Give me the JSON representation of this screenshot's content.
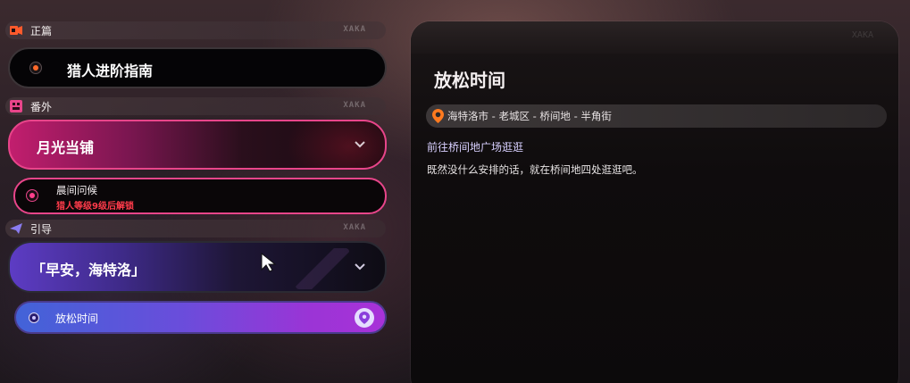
{
  "sections": {
    "main": {
      "label": "正篇",
      "icon": "main-story-icon",
      "mark": "XAKA"
    },
    "side": {
      "label": "番外",
      "icon": "side-story-icon",
      "mark": "XAKA"
    },
    "guide": {
      "label": "引导",
      "icon": "guide-icon",
      "mark": "XAKA"
    }
  },
  "quests": {
    "main": {
      "title": "猎人进阶指南"
    },
    "moon": {
      "title": "月光当铺"
    },
    "moon_sub": {
      "title": "晨间问候",
      "lock_text": "猎人等级9级后解锁"
    },
    "guide": {
      "title": "「早安，海特洛」"
    },
    "relax": {
      "title": "放松时间"
    }
  },
  "detail": {
    "title": "放松时间",
    "location": "海特洛市 - 老城区 - 桥间地 - 半角街",
    "objective": "前往桥间地广场逛逛",
    "description": "既然没什么安排的话，就在桥间地四处逛逛吧。",
    "mark": "XAKA"
  },
  "colors": {
    "accent_pink": "#e8458a",
    "accent_purple": "#6a4ddb",
    "accent_orange": "#ff6a2a",
    "lock_red": "#ff3b4a"
  }
}
